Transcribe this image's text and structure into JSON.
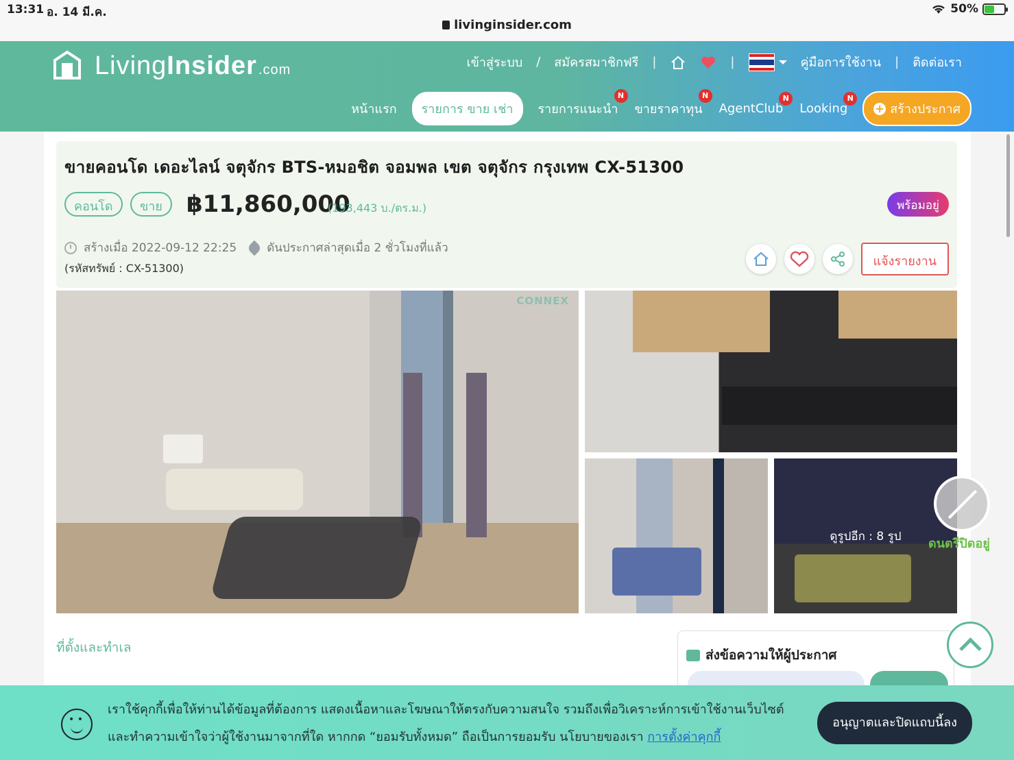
{
  "status_bar": {
    "time": "13:31",
    "date": "อ. 14 มี.ค.",
    "battery": "50%",
    "battery_level": 0.5
  },
  "browser": {
    "url": "livinginsider.com"
  },
  "header": {
    "logo": {
      "word1": "Living",
      "word2": "Insider",
      "suffix": ".com"
    },
    "top_links": {
      "login": "เข้าสู่ระบบ",
      "slash": "/",
      "register": "สมัครสมาชิกฟรี",
      "guide": "คู่มือการใช้งาน",
      "contact": "ติดต่อเรา"
    },
    "nav": [
      {
        "label": "หน้าแรก",
        "badge": ""
      },
      {
        "label": "รายการ ขาย เช่า",
        "badge": ""
      },
      {
        "label": "รายการแนะนำ",
        "badge": "N"
      },
      {
        "label": "ขายราคาทุน",
        "badge": "N"
      },
      {
        "label": "AgentClub",
        "badge": "N"
      },
      {
        "label": "Looking",
        "badge": "N"
      }
    ],
    "create_label": "สร้างประกาศ"
  },
  "listing": {
    "title": "ขายคอนโด เดอะไลน์ จตุจักร BTS-หมอชิต จอมพล เขต จตุจักร กรุงเทพ CX-51300",
    "tags": [
      "คอนโด",
      "ขาย"
    ],
    "price": "฿11,860,000",
    "price_per_sqm": "(193,443 บ./ตร.ม.)",
    "status": "พร้อมอยู่",
    "created": "สร้างเมื่อ 2022-09-12 22:25",
    "boosted": "ดันประกาศล่าสุดเมื่อ 2 ชั่วโมงที่แล้ว",
    "asset_code": "(รหัสทรัพย์ : CX-51300)",
    "report_label": "แจ้งรายงาน"
  },
  "gallery": {
    "watermark": "CONNEX",
    "more_photos": "ดูรูปอีก : 8 รูป"
  },
  "music": {
    "label": "ดนตรีปิดอยู่"
  },
  "sections": {
    "location": "ที่ตั้งและทำเล",
    "message_title": "ส่งข้อความให้ผู้ประกาศ"
  },
  "cookie": {
    "line1": "เราใช้คุกกี้เพื่อให้ท่านได้ข้อมูลที่ต้องการ แสดงเนื้อหาและโฆษณาให้ตรงกับความสนใจ รวมถึงเพื่อวิเคราะห์การเข้าใช้งานเว็บไซต์",
    "line2": "และทำความเข้าใจว่าผู้ใช้งานมาจากที่ใด หากกด “ยอมรับทั้งหมด” ถือเป็นการยอมรับ นโยบายของเรา ",
    "link": "การตั้งค่าคุกกี้",
    "button": "อนุญาตและปิดแถบนี้ลง"
  },
  "colors": {
    "brand_green": "#5fb89c",
    "accent_orange": "#f5a623",
    "report_red": "#e05555"
  }
}
